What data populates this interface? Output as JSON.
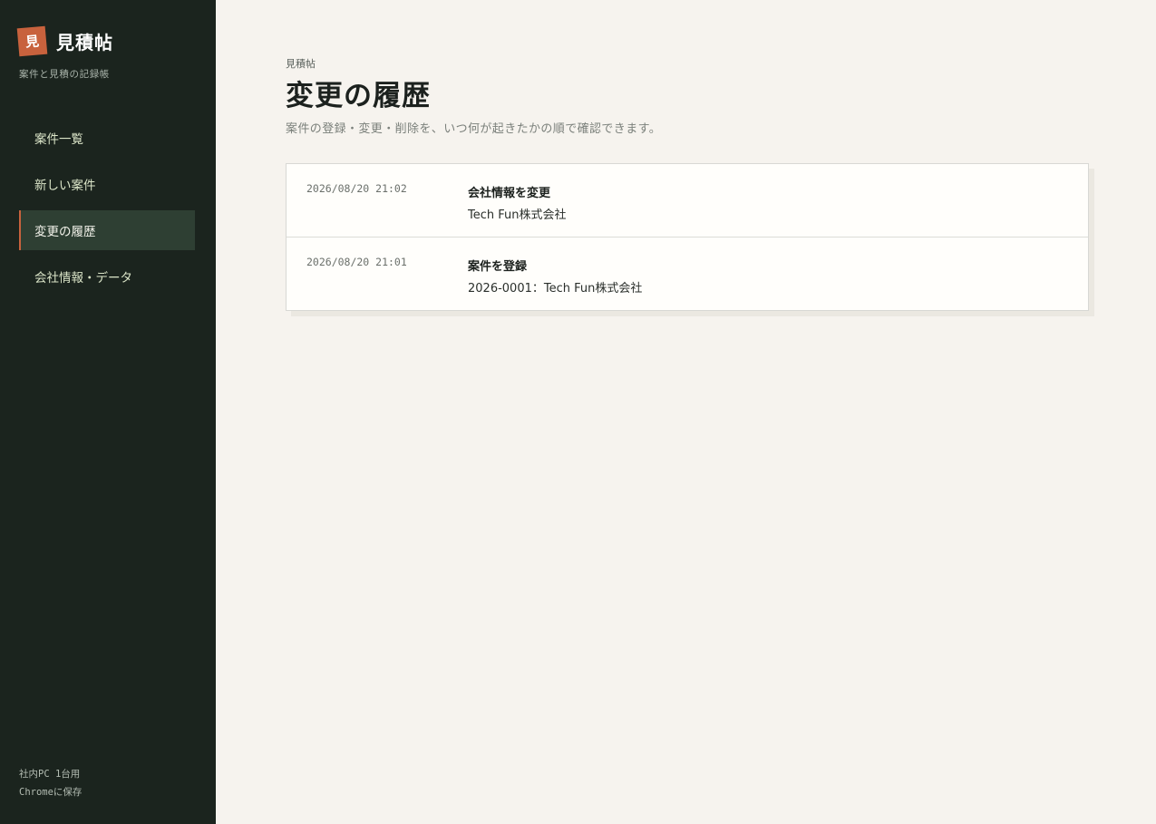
{
  "brand": {
    "mark": "見",
    "title": "見積帖",
    "subtitle": "案件と見積の記録帳"
  },
  "nav": {
    "items": [
      {
        "label": "案件一覧"
      },
      {
        "label": "新しい案件"
      },
      {
        "label": "変更の履歴",
        "active": true
      },
      {
        "label": "会社情報・データ"
      }
    ]
  },
  "footer": {
    "line1": "社内PC 1台用",
    "line2": "Chromeに保存"
  },
  "page": {
    "breadcrumb": "見積帖",
    "title": "変更の履歴",
    "description": "案件の登録・変更・削除を、いつ何が起きたかの順で確認できます。"
  },
  "history": [
    {
      "time": "2026/08/20 21:02",
      "title": "会社情報を変更",
      "detail": "Tech Fun株式会社"
    },
    {
      "time": "2026/08/20 21:01",
      "title": "案件を登録",
      "detail": "2026-0001：Tech Fun株式会社"
    }
  ],
  "colors": {
    "sidebar": "#1b241e",
    "accent": "#c8623d",
    "active_bg": "#2e3f33",
    "page_bg": "#f6f3ee"
  }
}
